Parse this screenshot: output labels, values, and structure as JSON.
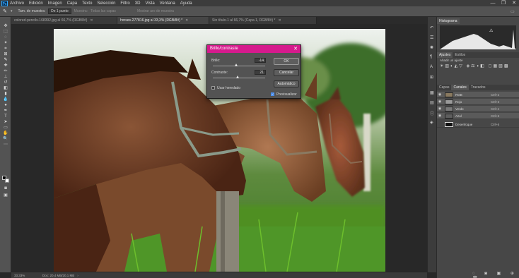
{
  "menu": [
    "Archivo",
    "Edición",
    "Imagen",
    "Capa",
    "Texto",
    "Selección",
    "Filtro",
    "3D",
    "Vista",
    "Ventana",
    "Ayuda"
  ],
  "window_controls": {
    "minimize": "—",
    "restore": "❐",
    "close": "✕"
  },
  "options_bar": {
    "sample_size_label": "Tam. de muestra:",
    "sample_size_value": "De 1 punto",
    "sample_label": "Muestra:",
    "sample_value": "Todas las capas",
    "sample_ring_label": "Mostrar aro de muestra"
  },
  "document_tabs": [
    {
      "label": "colored-pencils-168392.jpg al 66,7% (RGB/8#)",
      "active": false
    },
    {
      "label": "horses-277816.jpg al 33,3% (RGB/8#) *",
      "active": true
    },
    {
      "label": "Sin título-1 al 66,7% (Capa 1, RGB/8#) *",
      "active": false
    }
  ],
  "status": {
    "zoom": "33,33%",
    "doc_size": "Doc: 20,4 MB/20,1 MB"
  },
  "panels": {
    "histogram_tab": "Histograma",
    "adjust_tabs": [
      "Ajustes",
      "Estilos"
    ],
    "adjust_hint": "Añadir un ajuste",
    "layer_tabs": [
      "Capas",
      "Canales",
      "Trazados"
    ],
    "active_layer_tab": "Canales",
    "channels": [
      {
        "name": "RGB",
        "shortcut": "Ctrl+2",
        "color": "#8a7a60"
      },
      {
        "name": "Rojo",
        "shortcut": "Ctrl+3",
        "color": "#9a9a9a"
      },
      {
        "name": "Verde",
        "shortcut": "Ctrl+4",
        "color": "#7a7a7a"
      },
      {
        "name": "Azul",
        "shortcut": "Ctrl+5",
        "color": "#5e5e5e"
      },
      {
        "name": "Desenfoque",
        "shortcut": "Ctrl+6",
        "color": "#111111"
      }
    ]
  },
  "dialog": {
    "title": "Brillo/contraste",
    "brightness_label": "Brillo:",
    "brightness_value": "-14",
    "brightness_range": [
      -150,
      150
    ],
    "contrast_label": "Contraste:",
    "contrast_value": "21",
    "contrast_range": [
      -50,
      100
    ],
    "legacy_label": "Usar heredado",
    "legacy_checked": false,
    "ok": "OK",
    "cancel": "Cancelar",
    "auto": "Automático",
    "preview_label": "Previsualizar",
    "preview_checked": true
  }
}
